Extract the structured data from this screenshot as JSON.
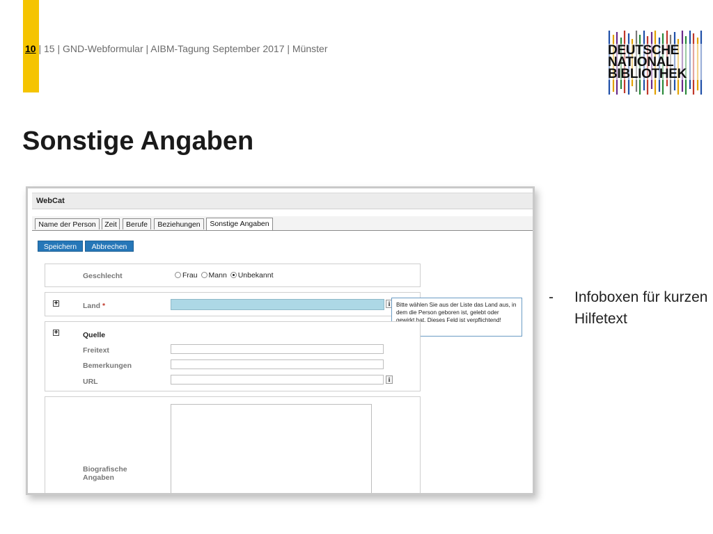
{
  "header": {
    "page_number": "10",
    "meta": "| 15 | GND-Webformular | AIBM-Tagung September 2017 | Münster",
    "accent_color": "#F5C400"
  },
  "logo": {
    "line1": "DEUTSCHE",
    "line2": "NATIONAL",
    "line3": "BIBLIOTHEK"
  },
  "title": "Sonstige Angaben",
  "app": {
    "name": "WebCat",
    "tabs": [
      {
        "label": "Name der Person",
        "active": false
      },
      {
        "label": "Zeit",
        "active": false
      },
      {
        "label": "Berufe",
        "active": false
      },
      {
        "label": "Beziehungen",
        "active": false
      },
      {
        "label": "Sonstige Angaben",
        "active": true
      }
    ],
    "buttons": {
      "save": "Speichern",
      "cancel": "Abbrechen"
    },
    "button_color": "#2677b8",
    "form": {
      "geschlecht": {
        "label": "Geschlecht",
        "options": [
          "Frau",
          "Mann",
          "Unbekannt"
        ],
        "selected": "Unbekannt"
      },
      "land": {
        "label": "Land",
        "required_mark": "*",
        "value": ""
      },
      "tooltip": "Bitte wählen Sie aus der Liste das Land aus, in dem die Person geboren ist, gelebt oder gewirkt hat. Dieses Feld ist verpflichtend!",
      "quelle": {
        "label": "Quelle",
        "freitext_label": "Freitext",
        "bemerkungen_label": "Bemerkungen",
        "url_label": "URL"
      },
      "biografische": {
        "label_line1": "Biografische",
        "label_line2": "Angaben"
      },
      "expand_symbol": "+",
      "info_symbol": "i"
    }
  },
  "side_note": {
    "dash": "-",
    "text": "Infoboxen für kurzen Hilfetext"
  }
}
